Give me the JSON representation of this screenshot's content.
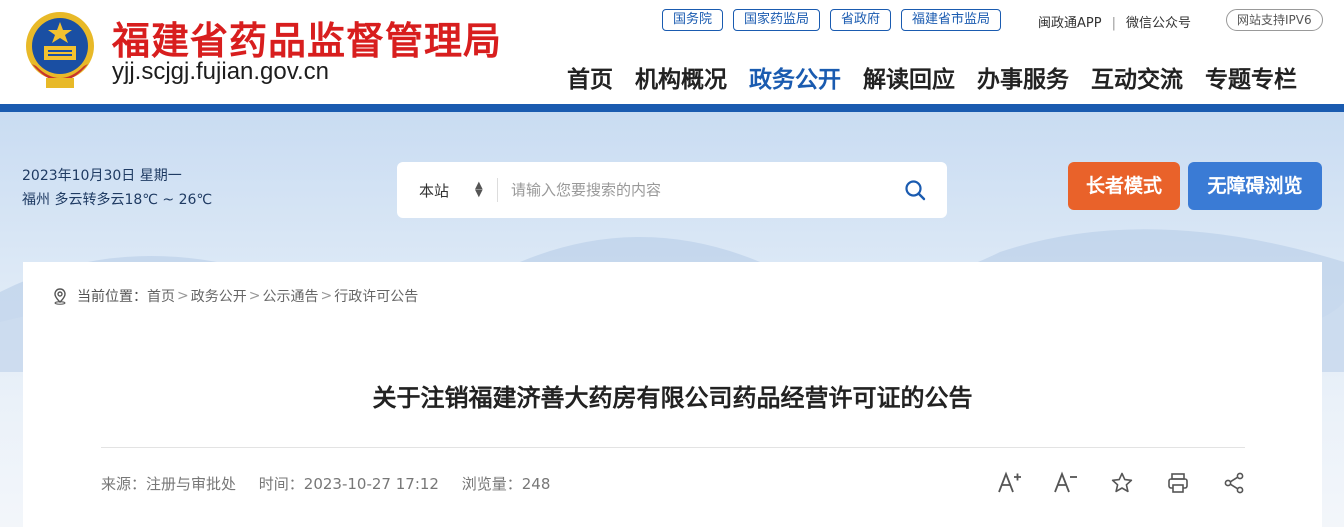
{
  "header": {
    "site_title": "福建省药品监督管理局",
    "domain": "yjj.scjgj.fujian.gov.cn",
    "top_links": [
      "国务院",
      "国家药监局",
      "省政府",
      "福建省市监局"
    ],
    "app_link": "闽政通APP",
    "separator": "|",
    "wechat_link": "微信公众号",
    "ipv6_badge": "网站支持IPV6",
    "nav": [
      {
        "label": "首页"
      },
      {
        "label": "机构概况"
      },
      {
        "label": "政务公开",
        "active": true
      },
      {
        "label": "解读回应"
      },
      {
        "label": "办事服务"
      },
      {
        "label": "互动交流"
      },
      {
        "label": "专题专栏"
      }
    ]
  },
  "banner": {
    "date_line": "2023年10月30日 星期一",
    "weather_line": "福州 多云转多云18℃ ~ 26℃",
    "search": {
      "scope_label": "本站",
      "placeholder": "请输入您要搜索的内容"
    },
    "elder_mode_label": "长者模式",
    "accessible_label": "无障碍浏览"
  },
  "breadcrumb": {
    "prefix": "当前位置：",
    "items": [
      "首页",
      "政务公开",
      "公示通告",
      "行政许可公告"
    ],
    "arrow": ">"
  },
  "article": {
    "title": "关于注销福建济善大药房有限公司药品经营许可证的公告",
    "source": "来源：注册与审批处",
    "time": "时间：2023-10-27 17:12",
    "views": "浏览量：248"
  },
  "colors": {
    "brand_blue": "#1a5bb0",
    "title_red": "#d81e1e",
    "elder_orange": "#e9622a",
    "access_blue": "#3a7bd5"
  },
  "icons": {
    "font_larger": "font-larger-icon",
    "font_smaller": "font-smaller-icon",
    "favorite": "star-icon",
    "print": "print-icon",
    "share": "share-icon"
  }
}
